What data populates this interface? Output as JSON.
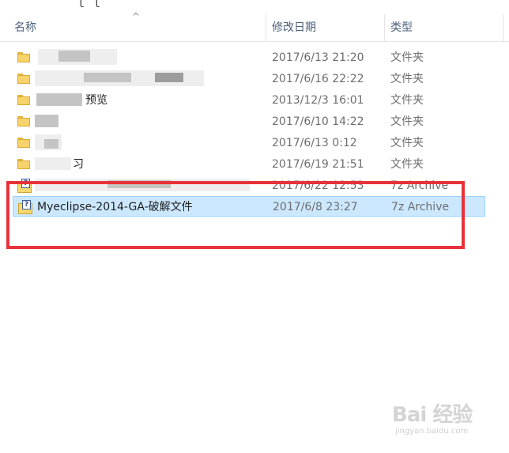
{
  "header": {
    "col_name": "名称",
    "col_date": "修改日期",
    "col_type": "类型",
    "sort_glyph": "^"
  },
  "rows": [
    {
      "name": "",
      "date": "2017/6/13 21:20",
      "type": "文件夹",
      "icon": "folder-icon"
    },
    {
      "name": "",
      "date": "2017/6/16 22:22",
      "type": "文件夹",
      "icon": "folder-icon"
    },
    {
      "name": "预览",
      "date": "2013/12/3 16:01",
      "type": "文件夹",
      "icon": "folder-icon"
    },
    {
      "name": "",
      "date": "2017/6/10 14:22",
      "type": "文件夹",
      "icon": "folder-icon"
    },
    {
      "name": "",
      "date": "2017/6/13 0:12",
      "type": "文件夹",
      "icon": "folder-icon"
    },
    {
      "name": "习",
      "date": "2017/6/19 21:51",
      "type": "文件夹",
      "icon": "folder-icon"
    },
    {
      "name": "",
      "date": "2017/6/22 12:53",
      "type": "7z Archive",
      "icon": "archive-icon"
    },
    {
      "name": "Myeclipse-2014-GA-破解文件",
      "date": "2017/6/8 23:27",
      "type": "7z Archive",
      "icon": "archive-icon",
      "selected": true
    }
  ],
  "watermark": {
    "logo": "Bai 经验",
    "url": "jingyan.baidu.com"
  },
  "colors": {
    "selection_bg": "#cce8ff",
    "selection_border": "#99d1ff",
    "highlight": "#e8323a",
    "header_text": "#4c607a"
  }
}
